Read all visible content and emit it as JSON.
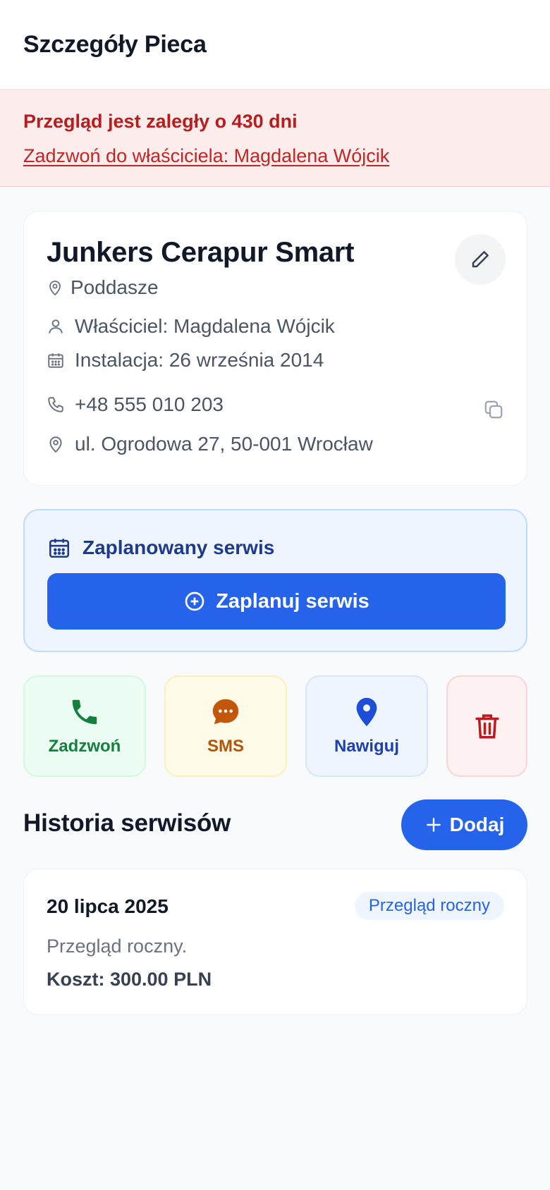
{
  "header": {
    "title": "Szczegóły Pieca"
  },
  "alert": {
    "title": "Przegląd jest zaległy o 430 dni",
    "link": "Zadzwoń do właściciela: Magdalena Wójcik"
  },
  "device": {
    "name": "Junkers Cerapur Smart",
    "location": "Poddasze",
    "owner": "Właściciel: Magdalena Wójcik",
    "installation": "Instalacja: 26 września 2014",
    "phone": "+48 555 010 203",
    "address": "ul. Ogrodowa 27, 50-001 Wrocław"
  },
  "service": {
    "heading": "Zaplanowany serwis",
    "button": "Zaplanuj serwis"
  },
  "actions": {
    "call": "Zadzwoń",
    "sms": "SMS",
    "navigate": "Nawiguj"
  },
  "history": {
    "title": "Historia serwisów",
    "add_label": "Dodaj",
    "entries": [
      {
        "date": "20 lipca 2025",
        "type": "Przegląd roczny",
        "description": "Przegląd roczny.",
        "cost": "Koszt: 300.00 PLN"
      }
    ]
  },
  "colors": {
    "primary": "#2563eb",
    "danger": "#b91c1c",
    "success": "#15803d",
    "warning": "#b45309"
  }
}
